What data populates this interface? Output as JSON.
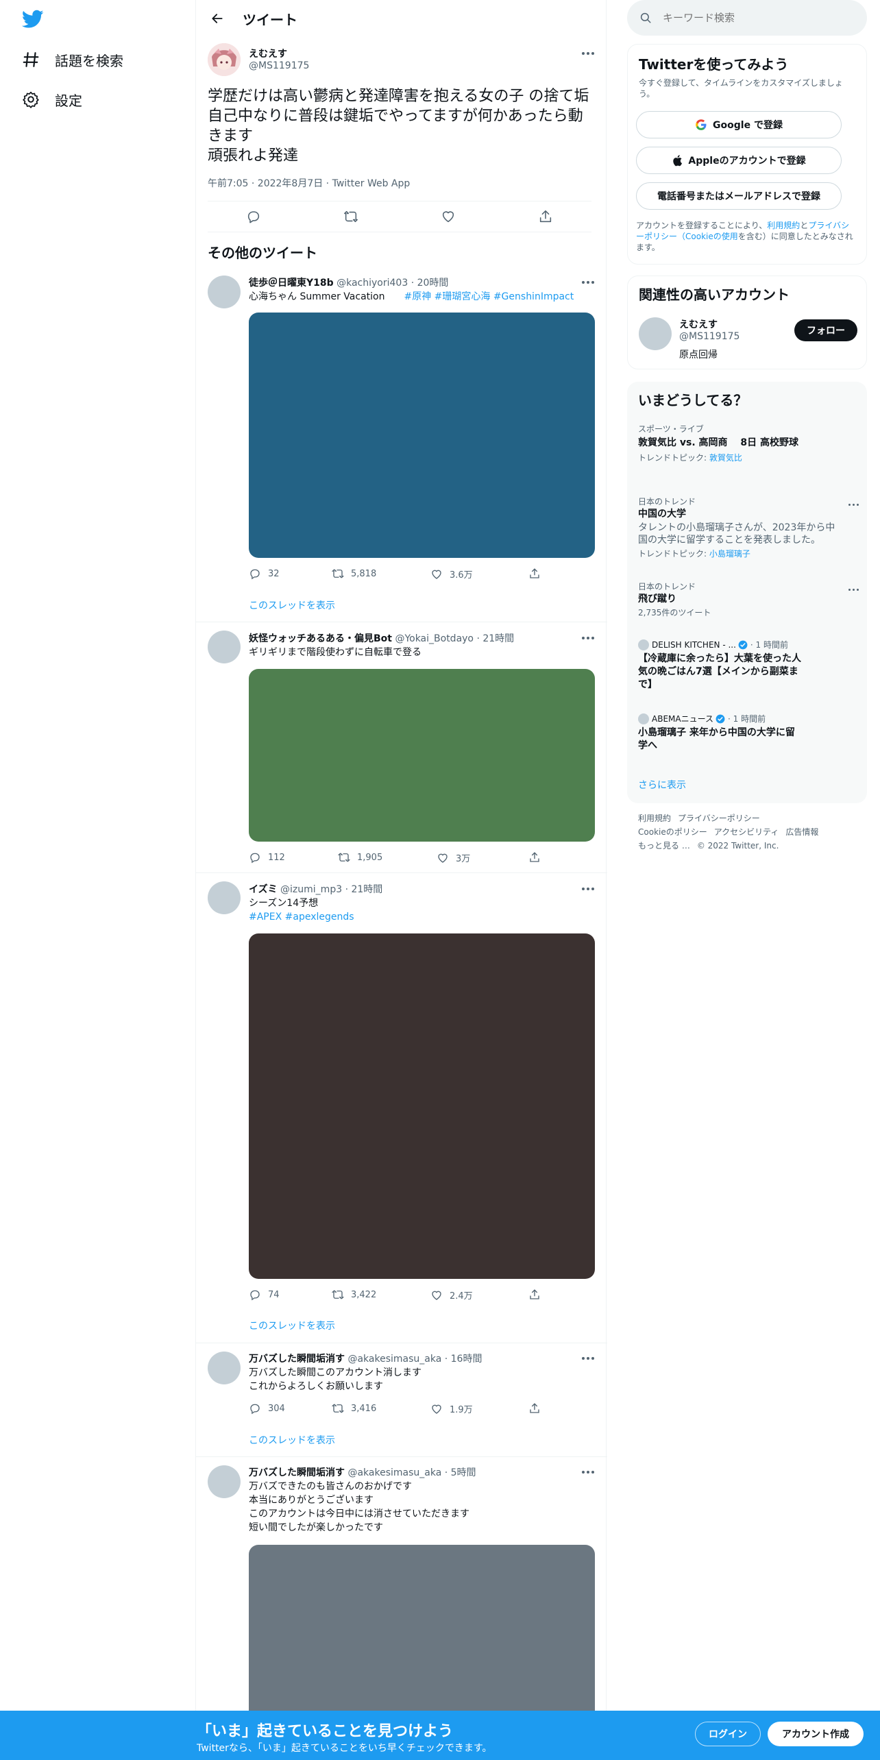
{
  "colors": {
    "accent": "#1d9bf0",
    "text": "#0f1419",
    "muted": "#536471",
    "bottom_bar": "#1d9bf0"
  },
  "nav": {
    "logo_icon": "twitter-bird-icon",
    "items": [
      {
        "icon": "hashtag-icon",
        "label": "話題を検索"
      },
      {
        "icon": "gear-icon",
        "label": "設定"
      }
    ]
  },
  "header": {
    "back_icon": "arrow-left-icon",
    "title": "ツイート"
  },
  "main_tweet": {
    "name": "えむえす",
    "handle": "@MS119175",
    "text": "学歴だけは高い鬱病と発達障害を抱える女の子 の捨て垢自己中なりに普段は鍵垢でやってますが何かあったら動きます\n頑張れよ発達",
    "meta": "午前7:05 · 2022年8月7日 · Twitter Web App"
  },
  "section_title": "その他のツイート",
  "tweets": [
    {
      "name": "徒歩＠日曜東Y18b",
      "handle": "@kachiyori403",
      "time": "· 20時間",
      "text": "心海ちゃん Summer Vacation　　",
      "hashtags": "#原神 #珊瑚宮心海 #GenshinImpact",
      "media_color": "#236285",
      "replies": "32",
      "retweets": "5,818",
      "likes": "3.6万",
      "thread": "このスレッドを表示"
    },
    {
      "name": "妖怪ウォッチあるある・偏見Bot",
      "handle": "@Yokai_Botdayo",
      "time": "· 21時間",
      "text": "ギリギリまで階段使わずに自転車で登る",
      "media_color": "#4f7f4f",
      "replies": "112",
      "retweets": "1,905",
      "likes": "3万"
    },
    {
      "name": "イズミ",
      "handle": "@izumi_mp3",
      "time": "· 21時間",
      "text": "シーズン14予想",
      "hashtags": " #APEX #apexlegends",
      "media_color": "#3b3130",
      "replies": "74",
      "retweets": "3,422",
      "likes": "2.4万",
      "thread": "このスレッドを表示"
    },
    {
      "name": "万バズした瞬間垢消す",
      "handle": "@akakesimasu_aka",
      "time": "· 16時間",
      "text": "万バズした瞬間このアカウント消します\nこれからよろしくお願いします",
      "replies": "304",
      "retweets": "3,416",
      "likes": "1.9万",
      "thread": "このスレッドを表示"
    },
    {
      "name": "万バズした瞬間垢消す",
      "handle": "@akakesimasu_aka",
      "time": "· 5時間",
      "text": "万バズできたのも皆さんのおかげです\n本当にありがとうございます\nこのアカウントは今日中には消させていただきます\n短い間でしたが楽しかったです",
      "media_color": "#6b7781"
    }
  ],
  "search": {
    "placeholder": "キーワード検索"
  },
  "signup_card": {
    "title": "Twitterを使ってみよう",
    "subtitle": "今すぐ登録して、タイムラインをカスタマイズしましょう。",
    "google": "Google で登録",
    "apple": "Appleのアカウントで登録",
    "phone": "電話番号またはメールアドレスで登録",
    "terms_pre": "アカウントを登録することにより、",
    "terms_link1": "利用規約",
    "terms_mid": "と",
    "terms_link2": "プライバシーポリシー（Cookieの使用",
    "terms_post": "を含む）に同意したとみなされます。"
  },
  "related": {
    "title": "関連性の高いアカウント",
    "name": "えむえす",
    "handle": "@MS119175",
    "bio": "原点回帰",
    "follow": "フォロー"
  },
  "trends": {
    "title": "いまどうしてる？",
    "items": [
      {
        "category": "スポーツ・ライブ",
        "name": "敦賀気比 vs. 高岡商　 8日 高校野球",
        "topic_label": "トレンドトピック: ",
        "topic": "敦賀気比"
      },
      {
        "category": "日本のトレンド",
        "name": "中国の大学",
        "desc": "タレントの小島瑠璃子さんが、2023年から中国の大学に留学することを発表しました。",
        "topic_label": "トレンドトピック: ",
        "topic": "小島瑠璃子"
      },
      {
        "category": "日本のトレンド",
        "name": "飛び蹴り",
        "meta": "2,735件のツイート"
      }
    ],
    "news": [
      {
        "source": "DELISH KITCHEN - ...",
        "time": "· 1 時間前",
        "headline": "【冷蔵庫に余ったら】大葉を使った人気の晩ごはん7選【メインから副菜まで】"
      },
      {
        "source": "ABEMAニュース",
        "time": "· 1 時間前",
        "headline": "小島瑠璃子 来年から中国の大学に留学へ"
      }
    ],
    "more": "さらに表示"
  },
  "footer": {
    "links": [
      "利用規約",
      "プライバシーポリシー",
      "Cookieのポリシー",
      "アクセシビリティ",
      "広告情報",
      "もっと見る …"
    ],
    "copyright": "© 2022 Twitter, Inc."
  },
  "bottom_bar": {
    "title": "「いま」起きていることを見つけよう",
    "subtitle": "Twitterなら、「いま」起きていることをいち早くチェックできます。",
    "login": "ログイン",
    "signup": "アカウント作成"
  }
}
